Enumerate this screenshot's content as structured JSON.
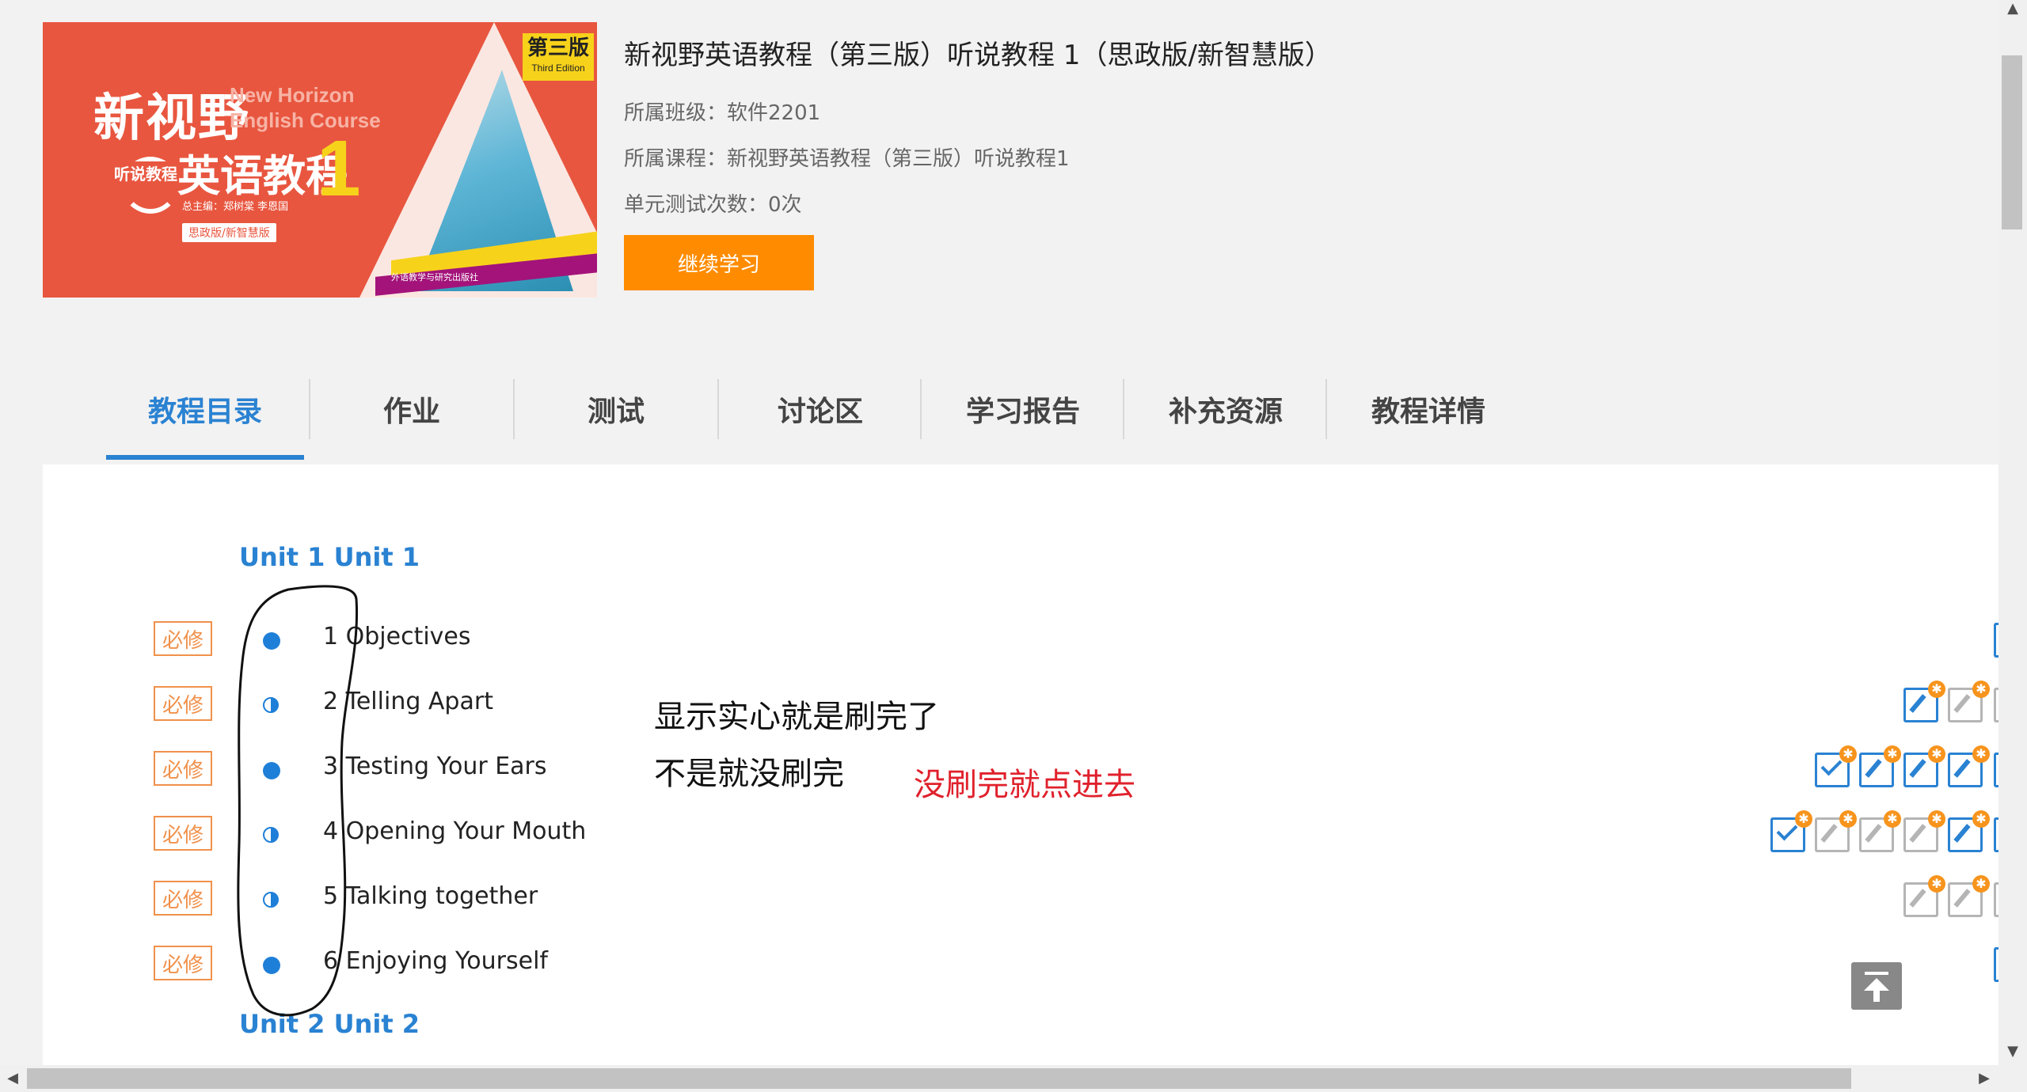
{
  "cover": {
    "badge_main": "第三版",
    "badge_sub": "Third Edition",
    "series_cn": "新视野",
    "series_en_line1": "New Horizon",
    "series_en_line2": "English Course",
    "sub_label": "听说教程",
    "main_title": "英语教程",
    "number": "1",
    "editors": "总主编：郑树棠 李恩国",
    "edition": "思政版/新智慧版",
    "publisher": "外语教学与研究出版社"
  },
  "course": {
    "title": "新视野英语教程（第三版）听说教程 1（思政版/新智慧版）",
    "class_label": "所属班级：软件2201",
    "course_label": "所属课程：新视野英语教程（第三版）听说教程1",
    "test_count_label": "单元测试次数：0次",
    "continue_label": "继续学习"
  },
  "tabs": [
    {
      "label": "教程目录",
      "active": true
    },
    {
      "label": "作业"
    },
    {
      "label": "测试"
    },
    {
      "label": "讨论区"
    },
    {
      "label": "学习报告"
    },
    {
      "label": "补充资源"
    },
    {
      "label": "教程详情"
    }
  ],
  "units": [
    {
      "title": "Unit 1 Unit 1",
      "lessons": [
        {
          "tag": "必修",
          "title": "1 Objectives",
          "status": "complete"
        },
        {
          "tag": "必修",
          "title": "2 Telling Apart",
          "status": "partial"
        },
        {
          "tag": "必修",
          "title": "3 Testing Your Ears",
          "status": "complete"
        },
        {
          "tag": "必修",
          "title": "4 Opening Your Mouth",
          "status": "partial"
        },
        {
          "tag": "必修",
          "title": "5 Talking together",
          "status": "partial"
        },
        {
          "tag": "必修",
          "title": "6 Enjoying Yourself",
          "status": "complete"
        }
      ]
    },
    {
      "title": "Unit 2 Unit 2"
    }
  ],
  "annotations": {
    "line1": "显示实心就是刷完了",
    "line2": "不是就没刷完",
    "red": "没刷完就点进去"
  },
  "colors": {
    "accent": "#2a82d2",
    "button": "#ff8c00",
    "tag": "#f0914b",
    "annotation_red": "#e0212c",
    "cover_bg": "#e8563f"
  },
  "icons": {
    "activity_edit": "edit-pencil-icon",
    "activity_check": "checklist-icon",
    "new_badge": "star-badge-icon",
    "back_to_top": "back-to-top-icon"
  }
}
